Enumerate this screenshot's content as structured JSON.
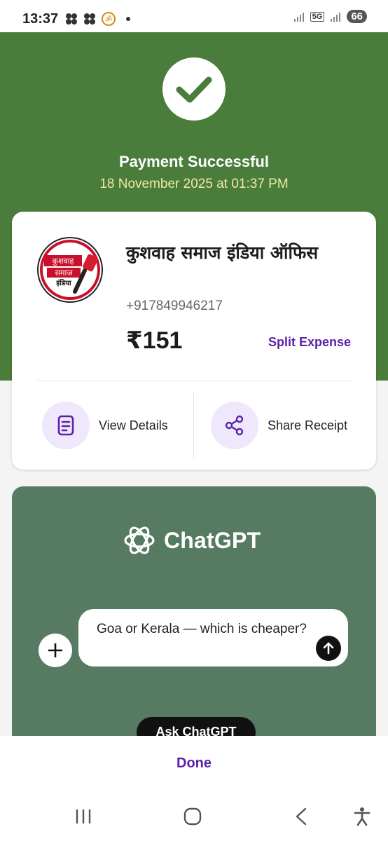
{
  "status_bar": {
    "time": "13:37",
    "battery": "66",
    "network": "5G"
  },
  "payment": {
    "title": "Payment Successful",
    "datetime": "18 November 2025 at 01:37 PM"
  },
  "merchant": {
    "name": "कुशवाह समाज इंडिया ऑफिस",
    "phone": "+917849946217",
    "amount": "₹151",
    "logo_text": [
      "कुशवाह",
      "समाज",
      "इंडिया"
    ]
  },
  "actions": {
    "split_label": "Split Expense",
    "view_details": "View Details",
    "share_receipt": "Share Receipt"
  },
  "promo": {
    "brand": "ChatGPT",
    "prompt": "Goa or Kerala — which is cheaper?",
    "cta": "Ask ChatGPT"
  },
  "footer": {
    "done_label": "Done"
  },
  "colors": {
    "header_green": "#4a7d3b",
    "accent_purple": "#5b22a8",
    "promo_green": "#567a62"
  }
}
